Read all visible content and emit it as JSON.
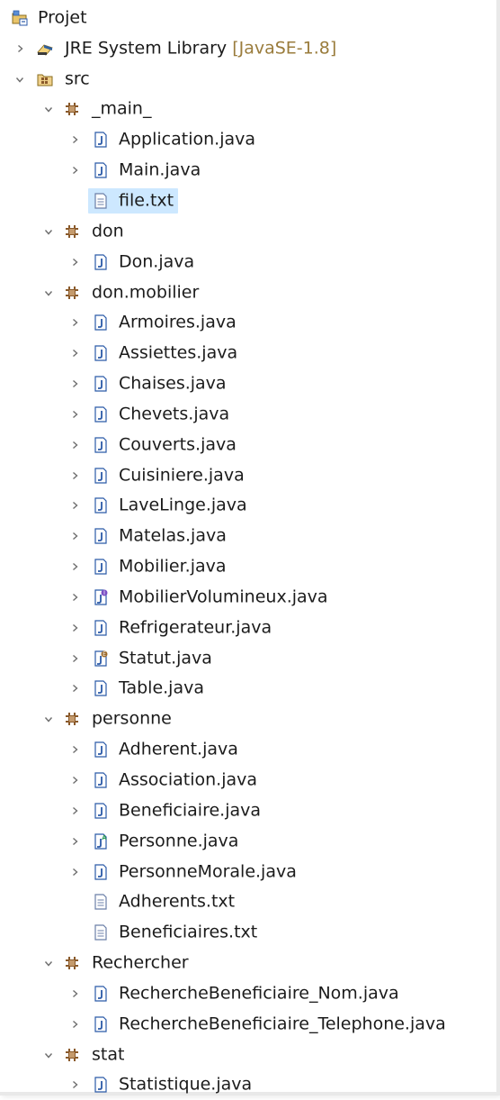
{
  "tree": [
    {
      "level": 0,
      "toggle": "none",
      "icon": "project-icon",
      "label": "Projet"
    },
    {
      "level": 1,
      "toggle": "collapsed",
      "icon": "library-icon",
      "label": "JRE System Library",
      "decoration": "[JavaSE-1.8]"
    },
    {
      "level": 1,
      "toggle": "expanded",
      "icon": "source-folder-icon",
      "label": "src"
    },
    {
      "level": 2,
      "toggle": "expanded",
      "icon": "package-icon",
      "label": "_main_"
    },
    {
      "level": 3,
      "toggle": "collapsed",
      "icon": "java-file-icon",
      "label": "Application.java"
    },
    {
      "level": 3,
      "toggle": "collapsed",
      "icon": "java-file-icon",
      "label": "Main.java"
    },
    {
      "level": 3,
      "toggle": "none",
      "icon": "text-file-icon",
      "label": "file.txt",
      "selected": true
    },
    {
      "level": 2,
      "toggle": "expanded",
      "icon": "package-icon",
      "label": "don"
    },
    {
      "level": 3,
      "toggle": "collapsed",
      "icon": "java-file-icon",
      "label": "Don.java"
    },
    {
      "level": 2,
      "toggle": "expanded",
      "icon": "package-icon",
      "label": "don.mobilier"
    },
    {
      "level": 3,
      "toggle": "collapsed",
      "icon": "java-file-icon",
      "label": "Armoires.java"
    },
    {
      "level": 3,
      "toggle": "collapsed",
      "icon": "java-file-icon",
      "label": "Assiettes.java"
    },
    {
      "level": 3,
      "toggle": "collapsed",
      "icon": "java-file-icon",
      "label": "Chaises.java"
    },
    {
      "level": 3,
      "toggle": "collapsed",
      "icon": "java-file-icon",
      "label": "Chevets.java"
    },
    {
      "level": 3,
      "toggle": "collapsed",
      "icon": "java-file-icon",
      "label": "Couverts.java"
    },
    {
      "level": 3,
      "toggle": "collapsed",
      "icon": "java-file-icon",
      "label": "Cuisiniere.java"
    },
    {
      "level": 3,
      "toggle": "collapsed",
      "icon": "java-file-icon",
      "label": "LaveLinge.java"
    },
    {
      "level": 3,
      "toggle": "collapsed",
      "icon": "java-file-icon",
      "label": "Matelas.java"
    },
    {
      "level": 3,
      "toggle": "collapsed",
      "icon": "java-file-icon",
      "label": "Mobilier.java"
    },
    {
      "level": 3,
      "toggle": "collapsed",
      "icon": "java-interface-file-icon",
      "label": "MobilierVolumineux.java"
    },
    {
      "level": 3,
      "toggle": "collapsed",
      "icon": "java-file-icon",
      "label": "Refrigerateur.java"
    },
    {
      "level": 3,
      "toggle": "collapsed",
      "icon": "java-enum-file-icon",
      "label": "Statut.java"
    },
    {
      "level": 3,
      "toggle": "collapsed",
      "icon": "java-file-icon",
      "label": "Table.java"
    },
    {
      "level": 2,
      "toggle": "expanded",
      "icon": "package-icon",
      "label": "personne"
    },
    {
      "level": 3,
      "toggle": "collapsed",
      "icon": "java-file-icon",
      "label": "Adherent.java"
    },
    {
      "level": 3,
      "toggle": "collapsed",
      "icon": "java-file-icon",
      "label": "Association.java"
    },
    {
      "level": 3,
      "toggle": "collapsed",
      "icon": "java-file-icon",
      "label": "Beneficiaire.java"
    },
    {
      "level": 3,
      "toggle": "collapsed",
      "icon": "java-abstract-file-icon",
      "label": "Personne.java"
    },
    {
      "level": 3,
      "toggle": "collapsed",
      "icon": "java-file-icon",
      "label": "PersonneMorale.java"
    },
    {
      "level": 3,
      "toggle": "none",
      "icon": "text-file-icon",
      "label": "Adherents.txt"
    },
    {
      "level": 3,
      "toggle": "none",
      "icon": "text-file-icon",
      "label": "Beneficiaires.txt"
    },
    {
      "level": 2,
      "toggle": "expanded",
      "icon": "package-icon",
      "label": "Rechercher"
    },
    {
      "level": 3,
      "toggle": "collapsed",
      "icon": "java-file-icon",
      "label": "RechercheBeneficiaire_Nom.java"
    },
    {
      "level": 3,
      "toggle": "collapsed",
      "icon": "java-file-icon",
      "label": "RechercheBeneficiaire_Telephone.java"
    },
    {
      "level": 2,
      "toggle": "expanded",
      "icon": "package-icon",
      "label": "stat"
    },
    {
      "level": 3,
      "toggle": "collapsed",
      "icon": "java-file-icon",
      "label": "Statistique.java"
    }
  ],
  "colors": {
    "selection": "#cde8ff",
    "decoration": "#9a7c3c",
    "java_blue": "#2b5aa8",
    "package_brown": "#8a5a2b",
    "chevron": "#6e6e6e"
  }
}
